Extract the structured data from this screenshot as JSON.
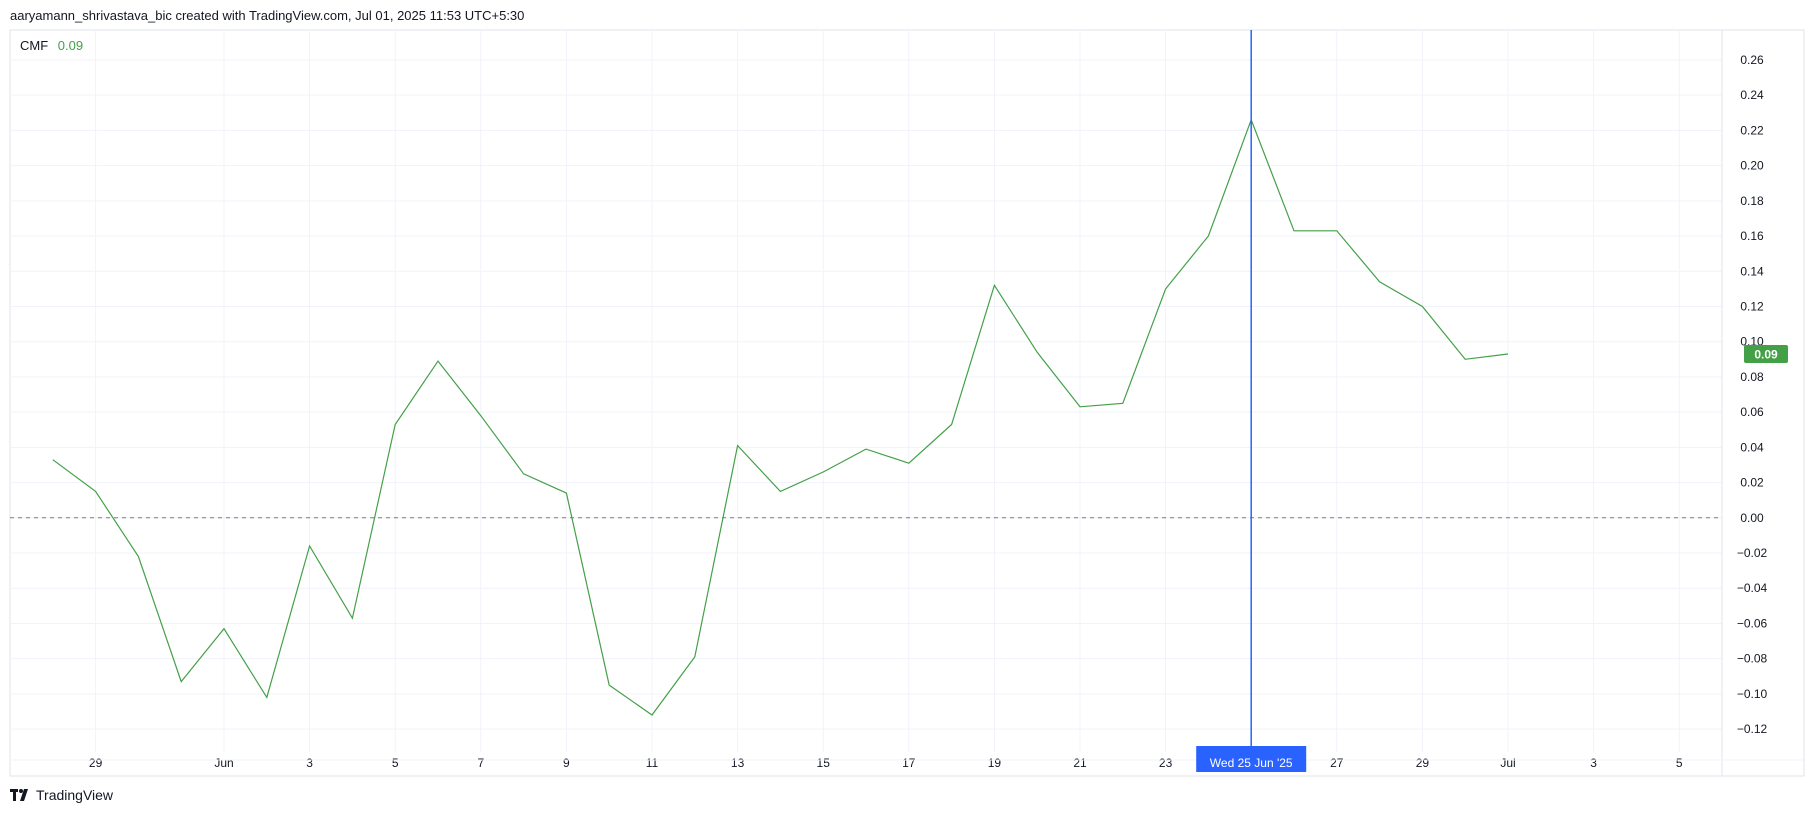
{
  "header": {
    "attribution": "aaryamann_shrivastava_bic created with TradingView.com, Jul 01, 2025 11:53 UTC+5:30"
  },
  "legend": {
    "indicator": "CMF",
    "value": "0.09"
  },
  "footer": {
    "brand": "TradingView"
  },
  "colors": {
    "line": "#43a047",
    "crosshair": "#2962ff",
    "badge": "#43a047",
    "grid": "#f0f3fa",
    "zero_line": "#787b86"
  },
  "chart_data": {
    "type": "line",
    "title": "",
    "xlabel": "",
    "ylabel": "",
    "series": [
      {
        "name": "CMF",
        "x": [
          "2025-05-28",
          "2025-05-29",
          "2025-05-30",
          "2025-05-31",
          "2025-06-01",
          "2025-06-02",
          "2025-06-03",
          "2025-06-04",
          "2025-06-05",
          "2025-06-06",
          "2025-06-07",
          "2025-06-08",
          "2025-06-09",
          "2025-06-10",
          "2025-06-11",
          "2025-06-12",
          "2025-06-13",
          "2025-06-14",
          "2025-06-15",
          "2025-06-16",
          "2025-06-17",
          "2025-06-18",
          "2025-06-19",
          "2025-06-20",
          "2025-06-21",
          "2025-06-22",
          "2025-06-23",
          "2025-06-24",
          "2025-06-25",
          "2025-06-26",
          "2025-06-27",
          "2025-06-28",
          "2025-06-29",
          "2025-06-30",
          "2025-07-01"
        ],
        "values": [
          0.033,
          0.015,
          -0.022,
          -0.093,
          -0.063,
          -0.102,
          -0.016,
          -0.057,
          0.053,
          0.089,
          0.058,
          0.025,
          0.014,
          -0.095,
          -0.112,
          -0.079,
          0.041,
          0.015,
          0.026,
          0.039,
          0.031,
          0.053,
          0.132,
          0.094,
          0.063,
          0.065,
          0.13,
          0.16,
          0.226,
          0.163,
          0.163,
          0.134,
          0.12,
          0.09,
          0.093
        ]
      }
    ],
    "x_ticks": [
      {
        "date": "2025-05-29",
        "label": "29"
      },
      {
        "date": "2025-06-01",
        "label": "Jun"
      },
      {
        "date": "2025-06-03",
        "label": "3"
      },
      {
        "date": "2025-06-05",
        "label": "5"
      },
      {
        "date": "2025-06-07",
        "label": "7"
      },
      {
        "date": "2025-06-09",
        "label": "9"
      },
      {
        "date": "2025-06-11",
        "label": "11"
      },
      {
        "date": "2025-06-13",
        "label": "13"
      },
      {
        "date": "2025-06-15",
        "label": "15"
      },
      {
        "date": "2025-06-17",
        "label": "17"
      },
      {
        "date": "2025-06-19",
        "label": "19"
      },
      {
        "date": "2025-06-21",
        "label": "21"
      },
      {
        "date": "2025-06-23",
        "label": "23"
      },
      {
        "date": "2025-06-27",
        "label": "27"
      },
      {
        "date": "2025-06-29",
        "label": "29"
      },
      {
        "date": "2025-07-01",
        "label": "Jul"
      },
      {
        "date": "2025-07-03",
        "label": "3"
      },
      {
        "date": "2025-07-05",
        "label": "5"
      }
    ],
    "y_ticks": [
      "0.26",
      "0.24",
      "0.22",
      "0.20",
      "0.18",
      "0.16",
      "0.14",
      "0.12",
      "0.10",
      "0.08",
      "0.06",
      "0.04",
      "0.02",
      "0.00",
      "−0.02",
      "−0.04",
      "−0.06",
      "−0.08",
      "−0.10",
      "−0.12"
    ],
    "y_tick_values": [
      0.26,
      0.24,
      0.22,
      0.2,
      0.18,
      0.16,
      0.14,
      0.12,
      0.1,
      0.08,
      0.06,
      0.04,
      0.02,
      0.0,
      -0.02,
      -0.04,
      -0.06,
      -0.08,
      -0.1,
      -0.12
    ],
    "ylim": [
      -0.133,
      0.277
    ],
    "xlim": [
      "2025-05-27",
      "2025-07-06"
    ],
    "reference_line": 0.0,
    "crosshair": {
      "date": "2025-06-25",
      "label": "Wed 25 Jun '25"
    },
    "last_value_badge": {
      "value": 0.093,
      "label": "0.09"
    },
    "grid": true
  }
}
